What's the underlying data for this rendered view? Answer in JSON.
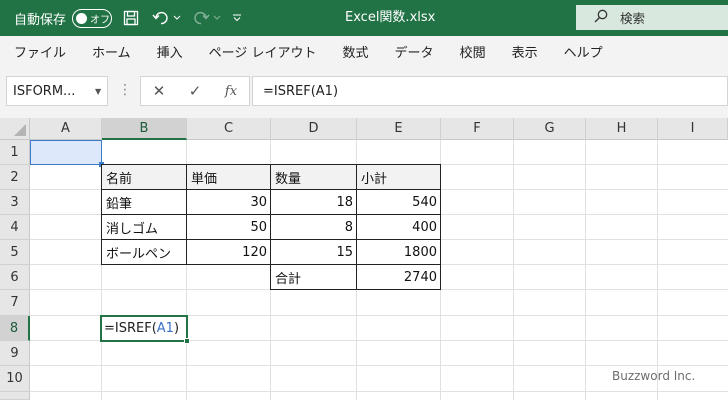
{
  "titlebar": {
    "autosave_label": "自動保存",
    "autosave_state": "オフ",
    "filename": "Excel関数.xlsx",
    "search_placeholder": "検索",
    "accent_color": "#217346"
  },
  "ribbon": {
    "tabs": [
      "ファイル",
      "ホーム",
      "挿入",
      "ページ レイアウト",
      "数式",
      "データ",
      "校閲",
      "表示",
      "ヘルプ"
    ]
  },
  "formula_bar": {
    "name_box": "ISFORM...",
    "fx_label": "fx",
    "formula": "=ISREF(A1)"
  },
  "sheet": {
    "columns": [
      "A",
      "B",
      "C",
      "D",
      "E",
      "F",
      "G",
      "H",
      "I"
    ],
    "rows": [
      "1",
      "2",
      "3",
      "4",
      "5",
      "6",
      "7",
      "8",
      "9",
      "10"
    ],
    "table": {
      "headers": [
        "名前",
        "単価",
        "数量",
        "小計"
      ],
      "rows": [
        [
          "鉛筆",
          "30",
          "18",
          "540"
        ],
        [
          "消しゴム",
          "50",
          "8",
          "400"
        ],
        [
          "ボールペン",
          "120",
          "15",
          "1800"
        ]
      ],
      "total_label": "合計",
      "total_value": "2740"
    },
    "active_cell": {
      "ref": "B8",
      "formula_prefix": "=ISREF(",
      "formula_ref": "A1",
      "formula_suffix": ")"
    }
  },
  "watermark": "Buzzword Inc."
}
